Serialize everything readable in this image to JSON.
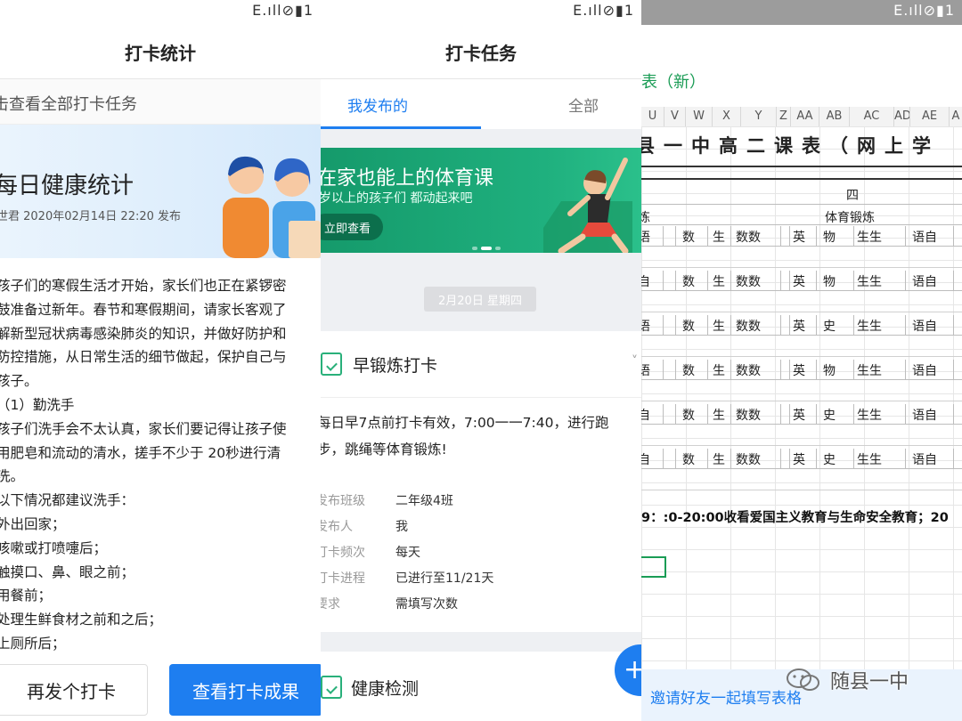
{
  "status": {
    "left_panel": "E.ıll⊘▮1",
    "middle_panel": "E.ıll⊘▮1",
    "right_panel": "E.ıll⊘▮1"
  },
  "stats_screen": {
    "title": "打卡统计",
    "view_all_link": "击查看全部打卡任务",
    "banner": {
      "title": "每日健康统计",
      "meta": "世君  2020年02月14日 22:20 发布"
    },
    "article_lines": [
      "孩子们的寒假生活才开始，家长们也正在紧锣密",
      "鼓准备过新年。春节和寒假期间，请家长客观了",
      "解新型冠状病毒感染肺炎的知识，并做好防护和",
      "防控措施，从日常生活的细节做起，保护自己与",
      "孩子。",
      "（1）勤洗手",
      "孩子们洗手会不太认真，家长们要记得让孩子使",
      "用肥皂和流动的清水，搓手不少于 20秒进行清",
      "洗。",
      "以下情况都建议洗手：",
      "外出回家；",
      "咳嗽或打喷嚏后；",
      "触摸口、鼻、眼之前；",
      "用餐前；",
      "处理生鲜食材之前和之后；",
      "上厕所后；"
    ],
    "buttons": {
      "resend": "再发个打卡",
      "view_results": "查看打卡成果"
    }
  },
  "task_screen": {
    "title": "打卡任务",
    "tabs": {
      "mine": "我发布的",
      "all": "全部"
    },
    "banner": {
      "title": "在家也能上的体育课",
      "subtitle": "岁以上的孩子们 都动起来吧",
      "cta": "立即查看"
    },
    "date_chip": "2月20日 星期四",
    "task": {
      "title": "早锻炼打卡",
      "chevron": "˅",
      "description_lines": [
        "每日早7点前打卡有效，7:00一一7:40，进行跑",
        "步，跳绳等体育锻炼!"
      ],
      "meta": [
        {
          "key": "发布班级",
          "value": "二年级4班"
        },
        {
          "key": "发布人",
          "value": "我"
        },
        {
          "key": "打卡频次",
          "value": "每天"
        },
        {
          "key": "打卡进程",
          "value": "已进行至11/21天"
        },
        {
          "key": "要求",
          "value": "需填写次数"
        }
      ]
    },
    "task2": {
      "title": "健康检测"
    },
    "fab_label": "+"
  },
  "sheet_screen": {
    "sheet_title": "表（新）",
    "columns": [
      "U",
      "V",
      "W",
      "X",
      "Y",
      "Z",
      "AA",
      "AB",
      "AC",
      "AD",
      "AE",
      "A"
    ],
    "big_title": "县一中高二课表（网上学",
    "day_header": "四",
    "subheaders": {
      "left": "炼",
      "center": "体育锻炼"
    },
    "rows": [
      [
        "语",
        "数",
        "生",
        "数数",
        "英",
        "物",
        "生生",
        "语自"
      ],
      [
        "自",
        "数",
        "生",
        "数数",
        "英",
        "物",
        "生生",
        "语自"
      ],
      [
        "语",
        "数",
        "生",
        "数数",
        "英",
        "史",
        "生生",
        "语自"
      ],
      [
        "语",
        "数",
        "生",
        "数数",
        "英",
        "物",
        "生生",
        "语自"
      ],
      [
        "自",
        "数",
        "生",
        "数数",
        "英",
        "史",
        "生生",
        "语自"
      ],
      [
        "自",
        "数",
        "生",
        "数数",
        "英",
        "史",
        "生生",
        "语自"
      ]
    ],
    "note": "9：:0-20:00收看爱国主义教育与生命安全教育；20",
    "invite_label": "邀请好友一起填写表格",
    "watermark": "随县一中"
  },
  "colors": {
    "primary_blue": "#1e7ef0",
    "green": "#1a9c55",
    "banner_green": "#1fb07e"
  }
}
